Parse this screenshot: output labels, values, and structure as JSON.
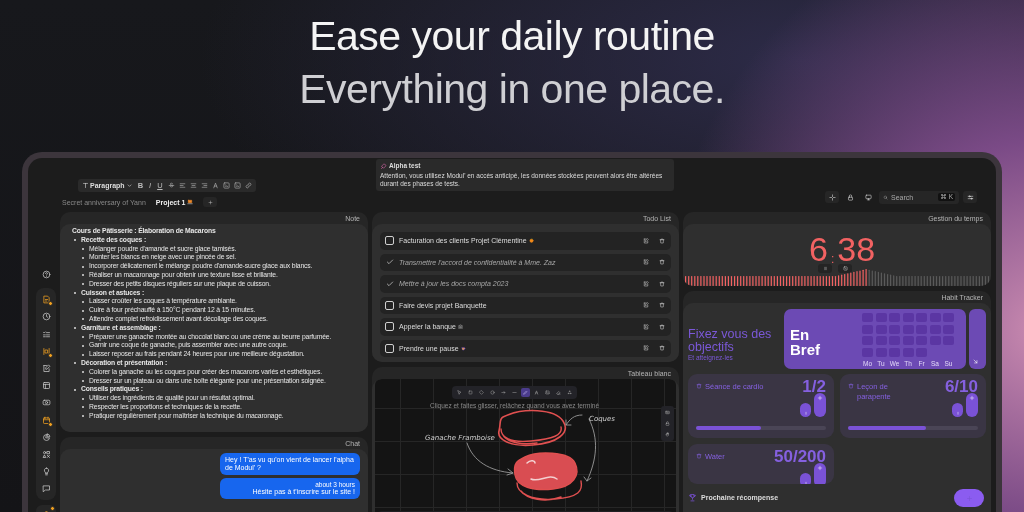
{
  "hero": {
    "title": "Ease your daily routine",
    "subtitle": "Everything in one place."
  },
  "editor_toolbar": {
    "block_style": "Paragraph",
    "format_buttons": [
      "B",
      "I",
      "U"
    ]
  },
  "tabs": [
    {
      "label": "Secret anniversary of Yann",
      "selected": false
    },
    {
      "label": "Project 1",
      "selected": true
    }
  ],
  "alert": {
    "title": "Alpha test",
    "message": "Attention, vous utilisez Modul' en accès anticipé, les données stockées peuvent alors être altérées durant des phases de tests."
  },
  "search": {
    "placeholder": "Search",
    "shortcut": "⌘ K"
  },
  "sidebar": {
    "items": [
      {
        "kind": "help",
        "highlighted": false,
        "badge": false
      },
      {
        "kind": "note",
        "highlighted": true,
        "badge": true
      },
      {
        "kind": "clock",
        "highlighted": false,
        "badge": false
      },
      {
        "kind": "list",
        "highlighted": false,
        "badge": false
      },
      {
        "kind": "habit",
        "highlighted": true,
        "badge": true
      },
      {
        "kind": "edit",
        "highlighted": false,
        "badge": false
      },
      {
        "kind": "layout",
        "highlighted": false,
        "badge": false
      },
      {
        "kind": "card",
        "highlighted": false,
        "badge": false
      },
      {
        "kind": "calendar",
        "highlighted": true,
        "badge": true
      },
      {
        "kind": "pie",
        "highlighted": false,
        "badge": false
      },
      {
        "kind": "shapes",
        "highlighted": false,
        "badge": false
      },
      {
        "kind": "bulb",
        "highlighted": false,
        "badge": false
      },
      {
        "kind": "chat",
        "highlighted": false,
        "badge": false
      },
      {
        "kind": "avatar",
        "highlighted": true,
        "badge": true
      }
    ]
  },
  "note": {
    "title": "Note",
    "heading": "Cours de Pâtisserie : Élaboration de Macarons",
    "sections": [
      {
        "text": "Recette des coques :",
        "children": [
          {
            "text": "Mélanger poudre d'amande et sucre glace tamisés."
          },
          {
            "text": "Monter les blancs en neige avec une pincée de sel."
          },
          {
            "text": "Incorporer délicatement le mélange poudre d'amande-sucre glace aux blancs."
          },
          {
            "text": "Réaliser un macaronage pour obtenir une texture lisse et brillante."
          },
          {
            "text": "Dresser des petits disques réguliers sur une plaque de cuisson."
          }
        ]
      },
      {
        "text": "Cuisson et astuces :",
        "children": [
          {
            "text": "Laisser croûter les coques à température ambiante."
          },
          {
            "text": "Cuire à four préchauffé à 150°C pendant 12 à 15 minutes."
          },
          {
            "text": "Attendre complet refroidissement avant décollage des coques."
          }
        ]
      },
      {
        "text": "Garniture et assemblage :",
        "children": [
          {
            "text": "Préparer une ganache montée au chocolat blanc ou une crème au beurre parfumée."
          },
          {
            "text": "Garnir une coque de ganache, puis assembler avec une autre coque."
          },
          {
            "text": "Laisser reposer au frais pendant 24 heures pour une meilleure dégustation."
          }
        ]
      },
      {
        "text": "Décoration et présentation :",
        "children": [
          {
            "text": "Colorer la ganache ou les coques pour créer des macarons variés et esthétiques."
          },
          {
            "text": "Dresser sur un plateau ou dans une boîte élégante pour une présentation soignée."
          }
        ]
      },
      {
        "text": "Conseils pratiques :",
        "children": [
          {
            "text": "Utiliser des ingrédients de qualité pour un résultat optimal."
          },
          {
            "text": "Respecter les proportions et techniques de la recette."
          },
          {
            "text": "Pratiquer régulièrement pour maîtriser la technique du macaronage."
          }
        ]
      }
    ]
  },
  "chat": {
    "title": "Chat",
    "messages": [
      {
        "text": "Hey ! T'as vu qu'on vient de lancer l'alpha de Modul' ?"
      },
      {
        "time": "about 3 hours",
        "text": "Hésite pas à t'inscrire sur le site !"
      }
    ]
  },
  "todo": {
    "title": "Todo List",
    "items": [
      {
        "text": "Facturation des clients Projet Clémentine",
        "done": false,
        "kind": "fruit"
      },
      {
        "text": "Transmettre l'accord de confidentialité à Mme. Zaz",
        "done": true,
        "kind": "plain"
      },
      {
        "text": "Mettre à jour les docs compta 2023",
        "done": true,
        "kind": "plain"
      },
      {
        "text": "Faire devis projet Banquette",
        "done": false,
        "kind": "plain"
      },
      {
        "text": "Appeler la banque",
        "done": false,
        "kind": "bank"
      },
      {
        "text": "Prendre une pause",
        "done": false,
        "kind": "cup"
      }
    ]
  },
  "whiteboard": {
    "title": "Tableau blanc",
    "hint": "Cliquez et faites glisser, relâchez quand vous avez terminé",
    "labels": [
      "Ganache Framboise",
      "Coques"
    ]
  },
  "timer": {
    "title": "Gestion du temps",
    "minutes": "6",
    "separator": ":",
    "seconds": "38",
    "level": 0.6
  },
  "habits": {
    "title": "Habit Tracker",
    "headline": "Fixez vous des objectifs",
    "tagline": "Et atteignez-les",
    "summary": {
      "title": "En Bref",
      "days": [
        "Mo",
        "Tu",
        "We",
        "Th",
        "Fr",
        "Sa",
        "Su"
      ]
    },
    "cards": [
      {
        "name": "Séance de cardio",
        "count": "1/2",
        "level": 0.5
      },
      {
        "name": "Leçon de parapente",
        "count": "6/10",
        "level": 0.6
      },
      {
        "name": "Water",
        "count": "50/200"
      }
    ],
    "reward": "Prochaine récompense"
  }
}
